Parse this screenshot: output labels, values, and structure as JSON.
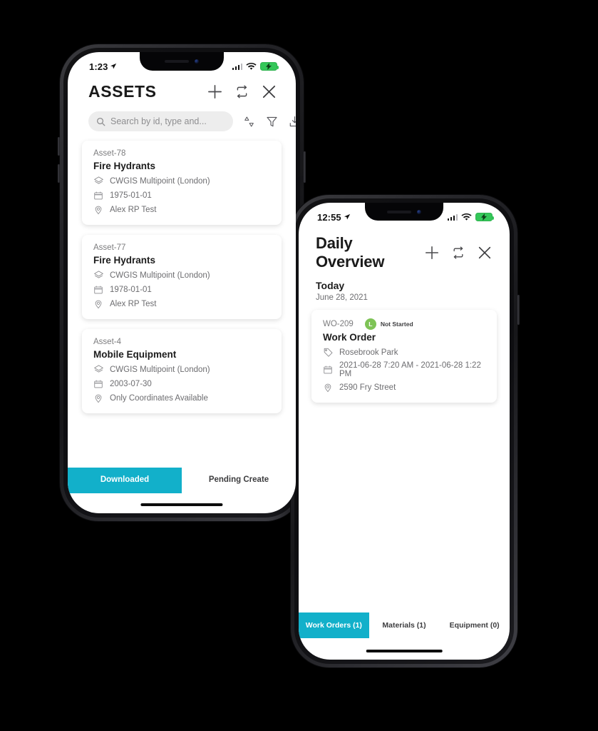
{
  "theme": {
    "accent": "#12b0ca",
    "status_green": "#7ec356",
    "battery_green": "#34c759"
  },
  "phone1": {
    "status": {
      "time": "1:23",
      "battery_icon": "battery-charging-icon",
      "wifi_icon": "wifi-icon",
      "cellular_icon": "cellular-bars-icon",
      "location_icon": "location-arrow-icon"
    },
    "header": {
      "title": "ASSETS",
      "actions": [
        {
          "name": "add-icon",
          "label": "+"
        },
        {
          "name": "sync-icon",
          "label": "sync"
        },
        {
          "name": "close-icon",
          "label": "close"
        }
      ]
    },
    "search": {
      "placeholder": "Search by id, type and...",
      "value": "",
      "icon": "search-icon"
    },
    "toolbar": [
      {
        "name": "sort-icon",
        "label": "Sort"
      },
      {
        "name": "filter-icon",
        "label": "Filter"
      },
      {
        "name": "download-icon",
        "label": "Download"
      }
    ],
    "cards": [
      {
        "id": "Asset-78",
        "title": "Fire Hydrants",
        "layer": "CWGIS Multipoint (London)",
        "date": "1975-01-01",
        "location": "Alex RP Test"
      },
      {
        "id": "Asset-77",
        "title": "Fire Hydrants",
        "layer": "CWGIS Multipoint (London)",
        "date": "1978-01-01",
        "location": "Alex RP Test"
      },
      {
        "id": "Asset-4",
        "title": "Mobile Equipment",
        "layer": "CWGIS Multipoint (London)",
        "date": "2003-07-30",
        "location": "Only Coordinates Available"
      }
    ],
    "tabs": [
      {
        "label": "Downloaded",
        "active": true
      },
      {
        "label": "Pending Create",
        "active": false
      }
    ]
  },
  "phone2": {
    "status": {
      "time": "12:55",
      "battery_icon": "battery-charging-icon",
      "wifi_icon": "wifi-icon",
      "cellular_icon": "cellular-bars-icon",
      "location_icon": "location-arrow-icon"
    },
    "header": {
      "title": "Daily Overview",
      "actions": [
        {
          "name": "add-icon",
          "label": "+"
        },
        {
          "name": "sync-icon",
          "label": "sync"
        },
        {
          "name": "close-icon",
          "label": "close"
        }
      ]
    },
    "section": {
      "title": "Today",
      "subtitle": "June 28, 2021"
    },
    "cards": [
      {
        "id": "WO-209",
        "status_letter": "L",
        "status_label": "Not Started",
        "title": "Work Order",
        "tag": "Rosebrook Park",
        "date": "2021-06-28 7:20 AM - 2021-06-28 1:22 PM",
        "location": "2590 Fry Street"
      }
    ],
    "tabs": [
      {
        "label": "Work Orders (1)",
        "active": true
      },
      {
        "label": "Materials (1)",
        "active": false
      },
      {
        "label": "Equipment (0)",
        "active": false
      }
    ]
  }
}
